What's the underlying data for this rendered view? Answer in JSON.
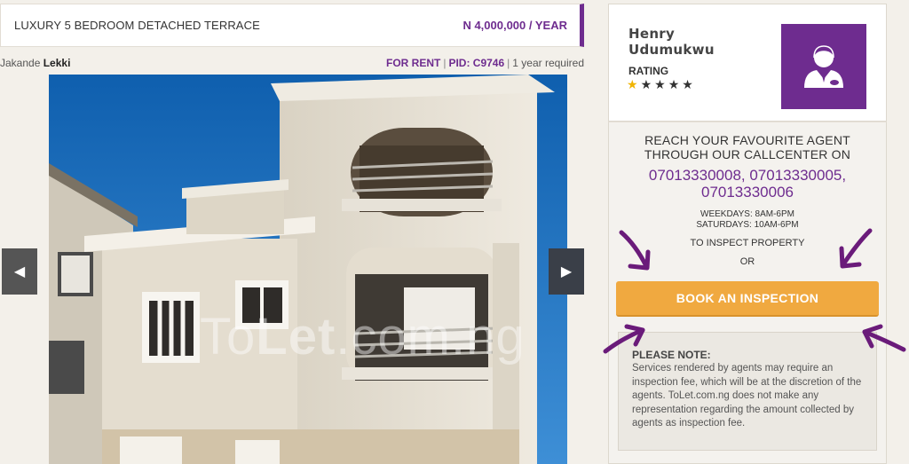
{
  "listing": {
    "title": "LUXURY 5 BEDROOM DETACHED TERRACE",
    "price": "N 4,000,000 / YEAR",
    "location_area": "Jakande",
    "location_city": "Lekki",
    "status": "FOR RENT",
    "pid": "PID: C9746",
    "requirement": "1 year required"
  },
  "gallery": {
    "watermark_prefix": "To",
    "watermark_bold": "Let",
    "watermark_suffix": ".com.ng",
    "prev_icon": "caret-left-icon",
    "next_icon": "caret-right-icon"
  },
  "agent": {
    "first_name": "Henry",
    "last_name": "Udumukwu",
    "rating_label": "RATING",
    "rating_value": 1,
    "rating_max": 5,
    "avatar_icon": "agent-avatar-icon",
    "avatar_bg": "#6e2c8f"
  },
  "callcenter": {
    "heading_line1": "REACH YOUR FAVOURITE AGENT",
    "heading_line2": "THROUGH OUR CALLCENTER ON",
    "numbers_line1": "07013330008, 07013330005,",
    "numbers_line2": "07013330006",
    "weekdays": "WEEKDAYS: 8AM-6PM",
    "saturdays": "SATURDAYS: 10AM-6PM",
    "inspect_text": "TO INSPECT PROPERTY",
    "or_text": "OR",
    "book_button": "BOOK AN INSPECTION",
    "accent_color": "#f0a940"
  },
  "note": {
    "title": "PLEASE NOTE:",
    "body": "Services rendered by agents may require an inspection fee, which will be at the discretion of the agents. ToLet.com.ng does not make any representation regarding the amount collected by agents as inspection fee."
  },
  "colors": {
    "brand_purple": "#6e2c8f",
    "annotation_arrow": "#6a1b7a"
  }
}
